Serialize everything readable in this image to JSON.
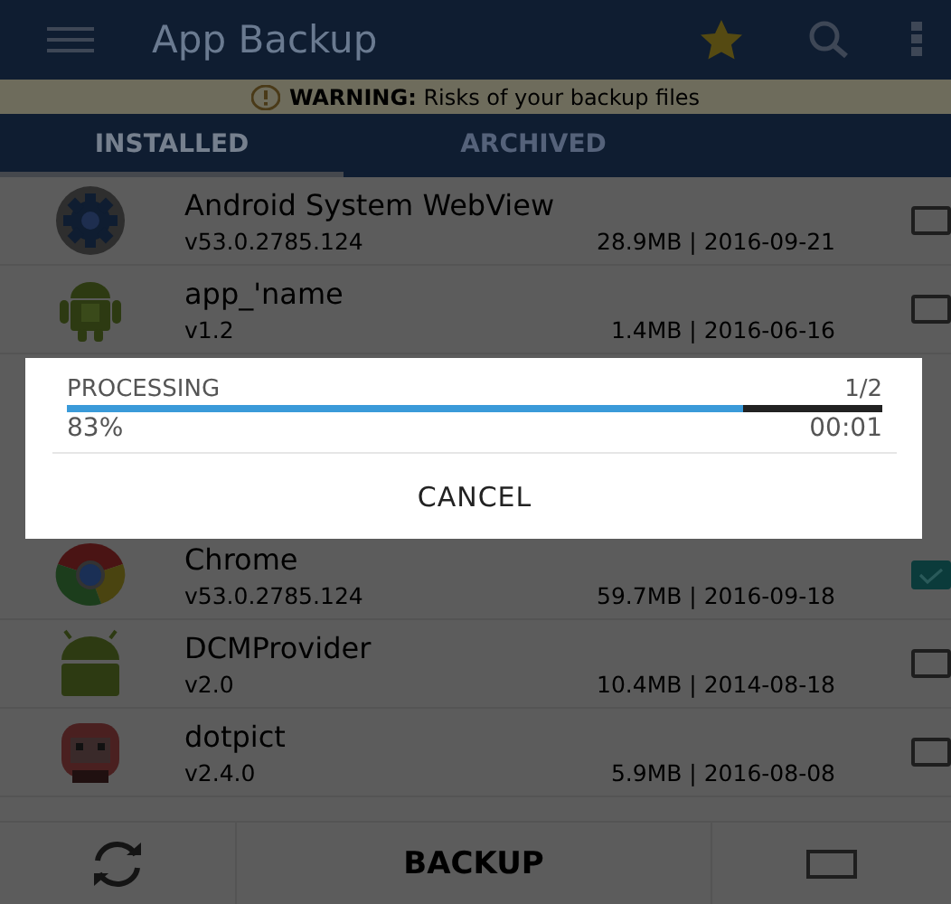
{
  "toolbar": {
    "title": "App Backup"
  },
  "warning": {
    "label": "WARNING:",
    "text": "Risks of your backup files"
  },
  "tabs": [
    {
      "label": "INSTALLED",
      "selected": true
    },
    {
      "label": "ARCHIVED",
      "selected": false
    }
  ],
  "apps": [
    {
      "name": "Android System WebView",
      "version": "v53.0.2785.124",
      "info": "28.9MB | 2016-09-21",
      "checked": false,
      "kind": "gear"
    },
    {
      "name": "app_'name",
      "version": "v1.2",
      "info": "1.4MB | 2016-06-16",
      "checked": false,
      "kind": "boxdroid"
    },
    {
      "hidden": true
    },
    {
      "name": "Chrome",
      "version": "v53.0.2785.124",
      "info": "59.7MB | 2016-09-18",
      "checked": true,
      "kind": "browser"
    },
    {
      "name": "DCMProvider",
      "version": "v2.0",
      "info": "10.4MB | 2014-08-18",
      "checked": false,
      "kind": "droid"
    },
    {
      "name": "dotpict",
      "version": "v2.4.0",
      "info": "5.9MB | 2016-08-08",
      "checked": false,
      "kind": "pixel"
    }
  ],
  "bottom_bar": {
    "button": "BACKUP",
    "select_all": false
  },
  "dialog": {
    "title": "PROCESSING",
    "count": "1/2",
    "level": 0.83,
    "percent": "83%",
    "time": "00:01",
    "button": "CANCEL"
  }
}
